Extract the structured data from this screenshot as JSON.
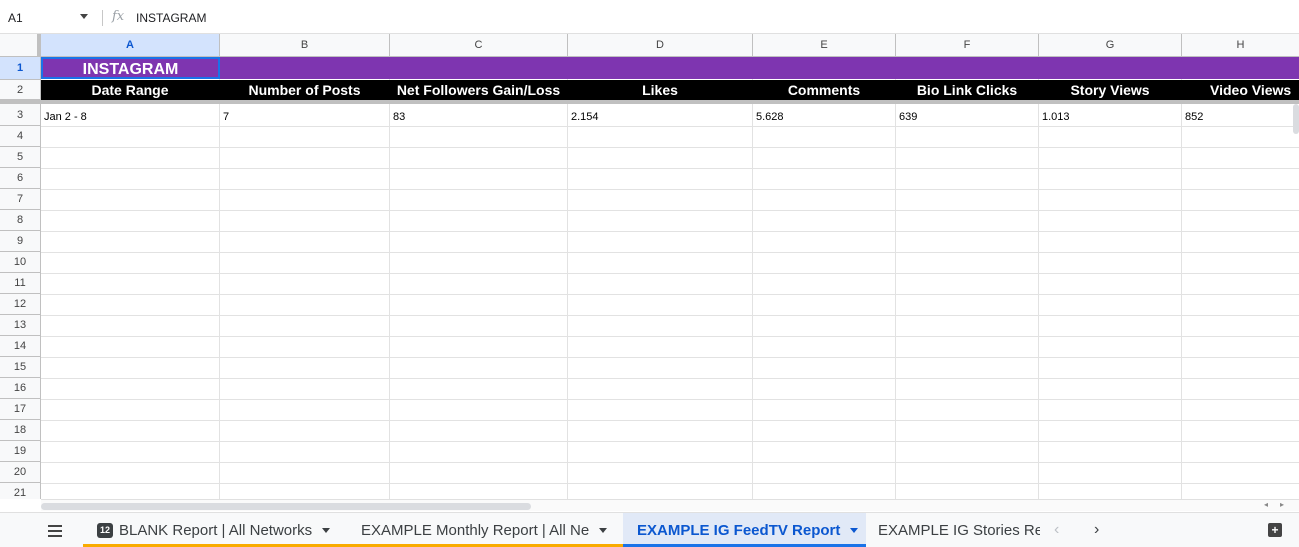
{
  "formula_bar": {
    "name_box": "A1",
    "fx_symbol": "fx",
    "content": "INSTAGRAM"
  },
  "columns": [
    "A",
    "B",
    "C",
    "D",
    "E",
    "F",
    "G",
    "H"
  ],
  "rows": [
    "1",
    "2",
    "3",
    "4",
    "5",
    "6",
    "7",
    "8",
    "9",
    "10",
    "11",
    "12",
    "13",
    "14",
    "15",
    "16",
    "17",
    "18",
    "19",
    "20",
    "21"
  ],
  "sheet": {
    "title": "INSTAGRAM",
    "headers": [
      "Date Range",
      "Number of Posts",
      "Net Followers Gain/Loss",
      "Likes",
      "Comments",
      "Bio Link Clicks",
      "Story Views",
      "Video Views"
    ],
    "data_rows": [
      [
        "Jan 2 - 8",
        "7",
        "83",
        "2.154",
        "5.628",
        "639",
        "1.013",
        "852"
      ]
    ],
    "title_color": "#7e35b0",
    "header_bg": "#000000"
  },
  "tabs": {
    "badge": "12",
    "items": [
      {
        "label": "BLANK Report | All Networks",
        "underline": "#f9ab00"
      },
      {
        "label": "EXAMPLE Monthly Report | All Ne",
        "underline": "#f9ab00"
      },
      {
        "label": "EXAMPLE IG FeedTV Report",
        "underline": "#1a73e8"
      },
      {
        "label": "EXAMPLE IG Stories Re",
        "underline": ""
      }
    ],
    "prev": "‹",
    "next": "›"
  },
  "icons": {
    "menu": "menu-icon",
    "explore": "explore-icon",
    "fx": "fx-icon"
  }
}
